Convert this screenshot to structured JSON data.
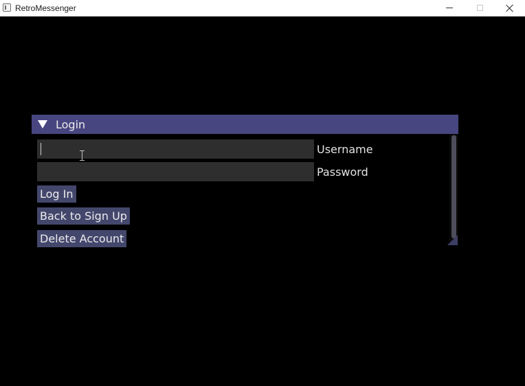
{
  "window": {
    "title": "RetroMessenger",
    "icon": "app-window-icon",
    "controls": {
      "minimize_icon": "minimize-icon",
      "maximize_icon": "maximize-icon",
      "close_icon": "close-icon"
    }
  },
  "login_panel": {
    "title": "Login",
    "collapse_icon": "triangle-down-icon",
    "header_color": "#484680",
    "button_color": "#44476c",
    "input_color": "#2e2e2e",
    "username": {
      "label": "Username",
      "value": ""
    },
    "password": {
      "label": "Password",
      "value": ""
    },
    "buttons": {
      "login": "Log In",
      "back_to_signup": "Back to Sign Up",
      "delete_account": "Delete Account"
    }
  }
}
